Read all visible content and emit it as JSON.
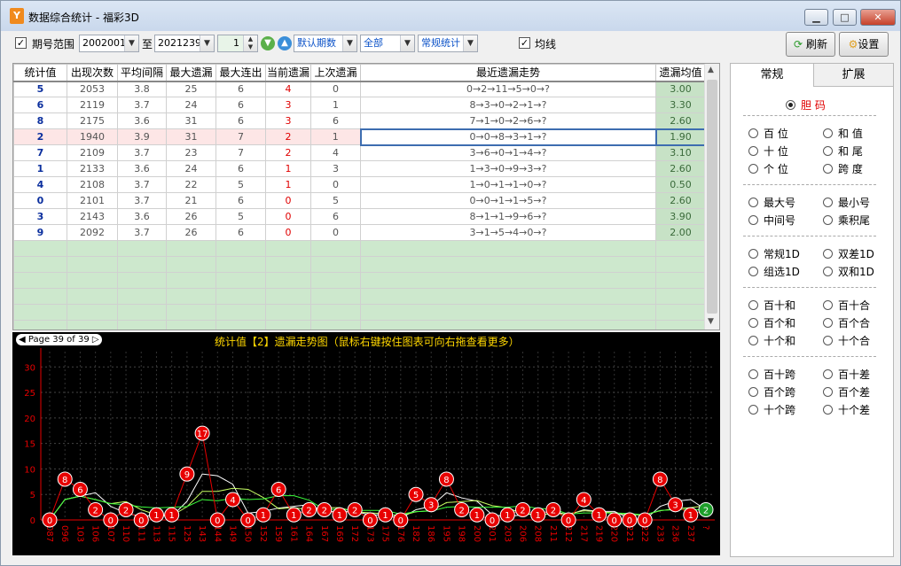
{
  "window": {
    "title": "数据综合统计 - 福彩3D",
    "app_icon": "app-logo",
    "min": "▁",
    "max": "□",
    "close": "✕"
  },
  "toolbar": {
    "period_range_label": "期号范围",
    "from": "2002001",
    "to_label": "至",
    "to": "2021239",
    "spin_value": "1",
    "period_combo": "默认期数",
    "scope_combo": "全部",
    "stat_combo": "常规统计",
    "avg_line_label": "均线",
    "refresh_label": "刷新",
    "settings_label": "设置"
  },
  "table": {
    "headers": [
      "统计值",
      "出现次数",
      "平均间隔",
      "最大遗漏",
      "最大连出",
      "当前遗漏",
      "上次遗漏",
      "最近遗漏走势",
      "遗漏均值"
    ],
    "rows": [
      [
        "5",
        "2053",
        "3.8",
        "25",
        "6",
        "4",
        "0",
        "0→2→11→5→0→?",
        "3.00"
      ],
      [
        "6",
        "2119",
        "3.7",
        "24",
        "6",
        "3",
        "1",
        "8→3→0→2→1→?",
        "3.30"
      ],
      [
        "8",
        "2175",
        "3.6",
        "31",
        "6",
        "3",
        "6",
        "7→1→0→2→6→?",
        "2.60"
      ],
      [
        "2",
        "1940",
        "3.9",
        "31",
        "7",
        "2",
        "1",
        "0→0→8→3→1→?",
        "1.90"
      ],
      [
        "7",
        "2109",
        "3.7",
        "23",
        "7",
        "2",
        "4",
        "3→6→0→1→4→?",
        "3.10"
      ],
      [
        "1",
        "2133",
        "3.6",
        "24",
        "6",
        "1",
        "3",
        "1→3→0→9→3→?",
        "2.60"
      ],
      [
        "4",
        "2108",
        "3.7",
        "22",
        "5",
        "1",
        "0",
        "1→0→1→1→0→?",
        "0.50"
      ],
      [
        "0",
        "2101",
        "3.7",
        "21",
        "6",
        "0",
        "5",
        "0→0→1→1→5→?",
        "2.60"
      ],
      [
        "3",
        "2143",
        "3.6",
        "26",
        "5",
        "0",
        "6",
        "8→1→1→9→6→?",
        "3.90"
      ],
      [
        "9",
        "2092",
        "3.7",
        "26",
        "6",
        "0",
        "0",
        "3→1→5→4→0→?",
        "2.00"
      ]
    ],
    "selected_row": 3,
    "empty_rows": 6
  },
  "chart_data": {
    "type": "line",
    "page_label": "Page 39 of 39",
    "title": "统计值【2】遗漏走势图（鼠标右键按住图表可向右拖查看更多）",
    "ylim": [
      0,
      33
    ],
    "yticks": [
      0,
      5,
      10,
      15,
      20,
      25,
      30
    ],
    "x": [
      "087",
      "096",
      "103",
      "106",
      "107",
      "110",
      "111",
      "113",
      "115",
      "125",
      "143",
      "144",
      "149",
      "150",
      "152",
      "159",
      "161",
      "164",
      "167",
      "169",
      "172",
      "173",
      "175",
      "176",
      "182",
      "186",
      "195",
      "198",
      "200",
      "201",
      "203",
      "206",
      "208",
      "211",
      "212",
      "217",
      "219",
      "220",
      "221",
      "222",
      "233",
      "236",
      "237",
      "?"
    ],
    "series": [
      {
        "values": [
          0,
          8,
          6,
          2,
          0,
          2,
          0,
          1,
          1,
          9,
          17,
          0,
          4,
          0,
          1,
          6,
          1,
          2,
          2,
          1,
          2,
          0,
          1,
          0,
          5,
          3,
          8,
          2,
          1,
          0,
          1,
          2,
          1,
          2,
          0,
          4,
          1,
          0,
          0,
          0,
          8,
          3,
          1,
          2
        ]
      }
    ],
    "bg_color": "#000000",
    "point_color": "#e80000",
    "current_point_color": "#1e9e2a",
    "line_color": "#e80000",
    "avg_line_colors": [
      "#ffffff",
      "#c8ff64",
      "#3cff3c"
    ],
    "axis_color": "#e80000"
  },
  "right_panel": {
    "tabs": [
      "常规",
      "扩展"
    ],
    "groups": [
      [
        "胆  码"
      ],
      [
        "百  位",
        "和  值",
        "十  位",
        "和  尾",
        "个  位",
        "跨  度"
      ],
      [
        "最大号",
        "最小号",
        "中间号",
        "乘积尾"
      ],
      [
        "常规1D",
        "双差1D",
        "组选1D",
        "双和1D"
      ],
      [
        "百十和",
        "百十合",
        "百个和",
        "百个合",
        "十个和",
        "十个合"
      ],
      [
        "百十跨",
        "百十差",
        "百个跨",
        "百个差",
        "十个跨",
        "十个差"
      ]
    ],
    "selected": "胆  码"
  }
}
